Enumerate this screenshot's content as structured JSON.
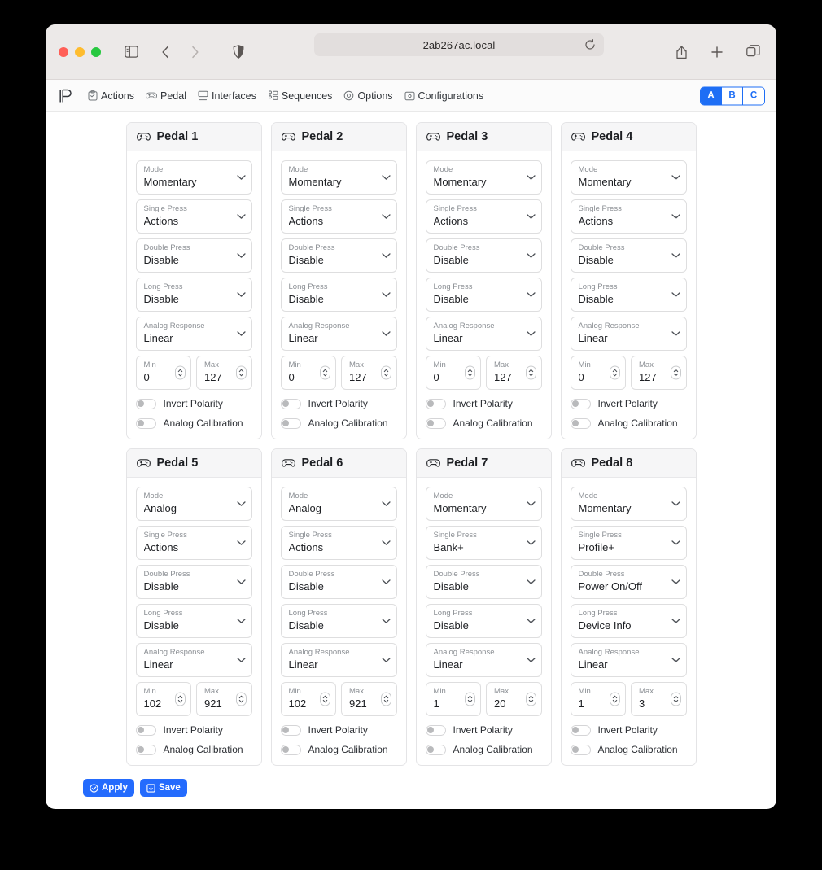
{
  "browser": {
    "url": "2ab267ac.local",
    "icons": {
      "sidebar": "sidebar-toggle-icon",
      "back": "back-arrow-icon",
      "forward": "forward-arrow-icon",
      "shield": "shield-icon",
      "reload": "reload-icon",
      "share": "share-icon",
      "new_tab": "plus-icon",
      "tabs": "tab-overview-icon"
    }
  },
  "app_nav": {
    "logo": "p-logo-icon",
    "items": [
      {
        "label": "Actions",
        "icon": "clipboard-icon"
      },
      {
        "label": "Pedal",
        "icon": "gamepad-icon"
      },
      {
        "label": "Interfaces",
        "icon": "interfaces-icon"
      },
      {
        "label": "Sequences",
        "icon": "sequences-icon"
      },
      {
        "label": "Options",
        "icon": "gear-icon"
      },
      {
        "label": "Configurations",
        "icon": "configurations-icon"
      }
    ],
    "profiles": [
      {
        "label": "A",
        "active": true
      },
      {
        "label": "B",
        "active": false
      },
      {
        "label": "C",
        "active": false
      }
    ]
  },
  "field_labels": {
    "mode": "Mode",
    "single_press": "Single Press",
    "double_press": "Double Press",
    "long_press": "Long Press",
    "analog_response": "Analog Response",
    "min": "Min",
    "max": "Max",
    "invert_polarity": "Invert Polarity",
    "analog_calibration": "Analog Calibration"
  },
  "pedals": [
    {
      "title": "Pedal 1",
      "mode": "Momentary",
      "single_press": "Actions",
      "double_press": "Disable",
      "long_press": "Disable",
      "analog_response": "Linear",
      "min": "0",
      "max": "127",
      "invert_polarity": false,
      "analog_calibration": false
    },
    {
      "title": "Pedal 2",
      "mode": "Momentary",
      "single_press": "Actions",
      "double_press": "Disable",
      "long_press": "Disable",
      "analog_response": "Linear",
      "min": "0",
      "max": "127",
      "invert_polarity": false,
      "analog_calibration": false
    },
    {
      "title": "Pedal 3",
      "mode": "Momentary",
      "single_press": "Actions",
      "double_press": "Disable",
      "long_press": "Disable",
      "analog_response": "Linear",
      "min": "0",
      "max": "127",
      "invert_polarity": false,
      "analog_calibration": false
    },
    {
      "title": "Pedal 4",
      "mode": "Momentary",
      "single_press": "Actions",
      "double_press": "Disable",
      "long_press": "Disable",
      "analog_response": "Linear",
      "min": "0",
      "max": "127",
      "invert_polarity": false,
      "analog_calibration": false
    },
    {
      "title": "Pedal 5",
      "mode": "Analog",
      "single_press": "Actions",
      "double_press": "Disable",
      "long_press": "Disable",
      "analog_response": "Linear",
      "min": "102",
      "max": "921",
      "invert_polarity": false,
      "analog_calibration": false
    },
    {
      "title": "Pedal 6",
      "mode": "Analog",
      "single_press": "Actions",
      "double_press": "Disable",
      "long_press": "Disable",
      "analog_response": "Linear",
      "min": "102",
      "max": "921",
      "invert_polarity": false,
      "analog_calibration": false
    },
    {
      "title": "Pedal 7",
      "mode": "Momentary",
      "single_press": "Bank+",
      "double_press": "Disable",
      "long_press": "Disable",
      "analog_response": "Linear",
      "min": "1",
      "max": "20",
      "invert_polarity": false,
      "analog_calibration": false
    },
    {
      "title": "Pedal 8",
      "mode": "Momentary",
      "single_press": "Profile+",
      "double_press": "Power On/Off",
      "long_press": "Device Info",
      "analog_response": "Linear",
      "min": "1",
      "max": "3",
      "invert_polarity": false,
      "analog_calibration": false
    }
  ],
  "footer": {
    "apply_label": "Apply",
    "save_label": "Save",
    "apply_icon": "check-circle-icon",
    "save_icon": "save-download-icon"
  },
  "colors": {
    "accent": "#246bfd",
    "profile_accent": "#1e6ef5",
    "card_header_bg": "#f6f6f7",
    "border": "#e4e4e6"
  }
}
